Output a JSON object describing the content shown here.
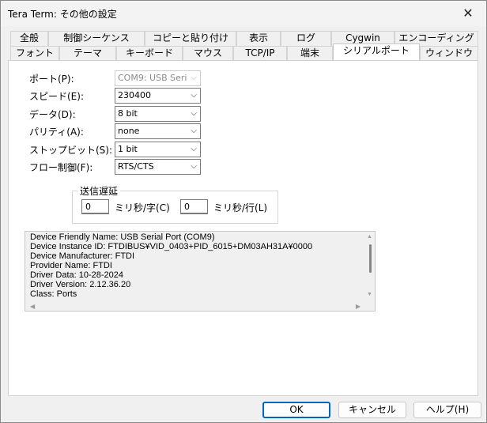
{
  "window": {
    "title": "Tera Term: その他の設定",
    "close_glyph": "✕"
  },
  "tabs_row1": [
    {
      "label": "全般"
    },
    {
      "label": "制御シーケンス"
    },
    {
      "label": "コピーと貼り付け"
    },
    {
      "label": "表示"
    },
    {
      "label": "ログ"
    },
    {
      "label": "Cygwin"
    },
    {
      "label": "エンコーディング"
    }
  ],
  "tabs_row2": [
    {
      "label": "フォント"
    },
    {
      "label": "テーマ"
    },
    {
      "label": "キーボード"
    },
    {
      "label": "マウス"
    },
    {
      "label": "TCP/IP"
    },
    {
      "label": "端末"
    },
    {
      "label": "シリアルポート",
      "active": true
    },
    {
      "label": "ウィンドウ"
    }
  ],
  "serial": {
    "port_label": "ポート(P):",
    "port_value": "COM9: USB Seri",
    "speed_label": "スピード(E):",
    "speed_value": "230400",
    "data_label": "データ(D):",
    "data_value": "8 bit",
    "parity_label": "パリティ(A):",
    "parity_value": "none",
    "stop_label": "ストップビット(S):",
    "stop_value": "1 bit",
    "flow_label": "フロー制御(F):",
    "flow_value": "RTS/CTS",
    "dropdown_glyph": "⌵"
  },
  "delay": {
    "legend": "送信遅延",
    "char_value": "0",
    "char_unit": "ミリ秒/字(C)",
    "line_value": "0",
    "line_unit": "ミリ秒/行(L)"
  },
  "device_info": [
    "Device Friendly Name: USB Serial Port (COM9)",
    "Device Instance ID: FTDIBUS¥VID_0403+PID_6015+DM03AH31A¥0000",
    "Device Manufacturer: FTDI",
    "Provider Name: FTDI",
    "Driver Data: 10-28-2024",
    "Driver Version: 2.12.36.20",
    "Class: Ports"
  ],
  "scroll": {
    "up": "▲",
    "down": "▼",
    "left": "◀",
    "right": "▶"
  },
  "buttons": {
    "ok": "OK",
    "cancel": "キャンセル",
    "help": "ヘルプ(H)"
  }
}
